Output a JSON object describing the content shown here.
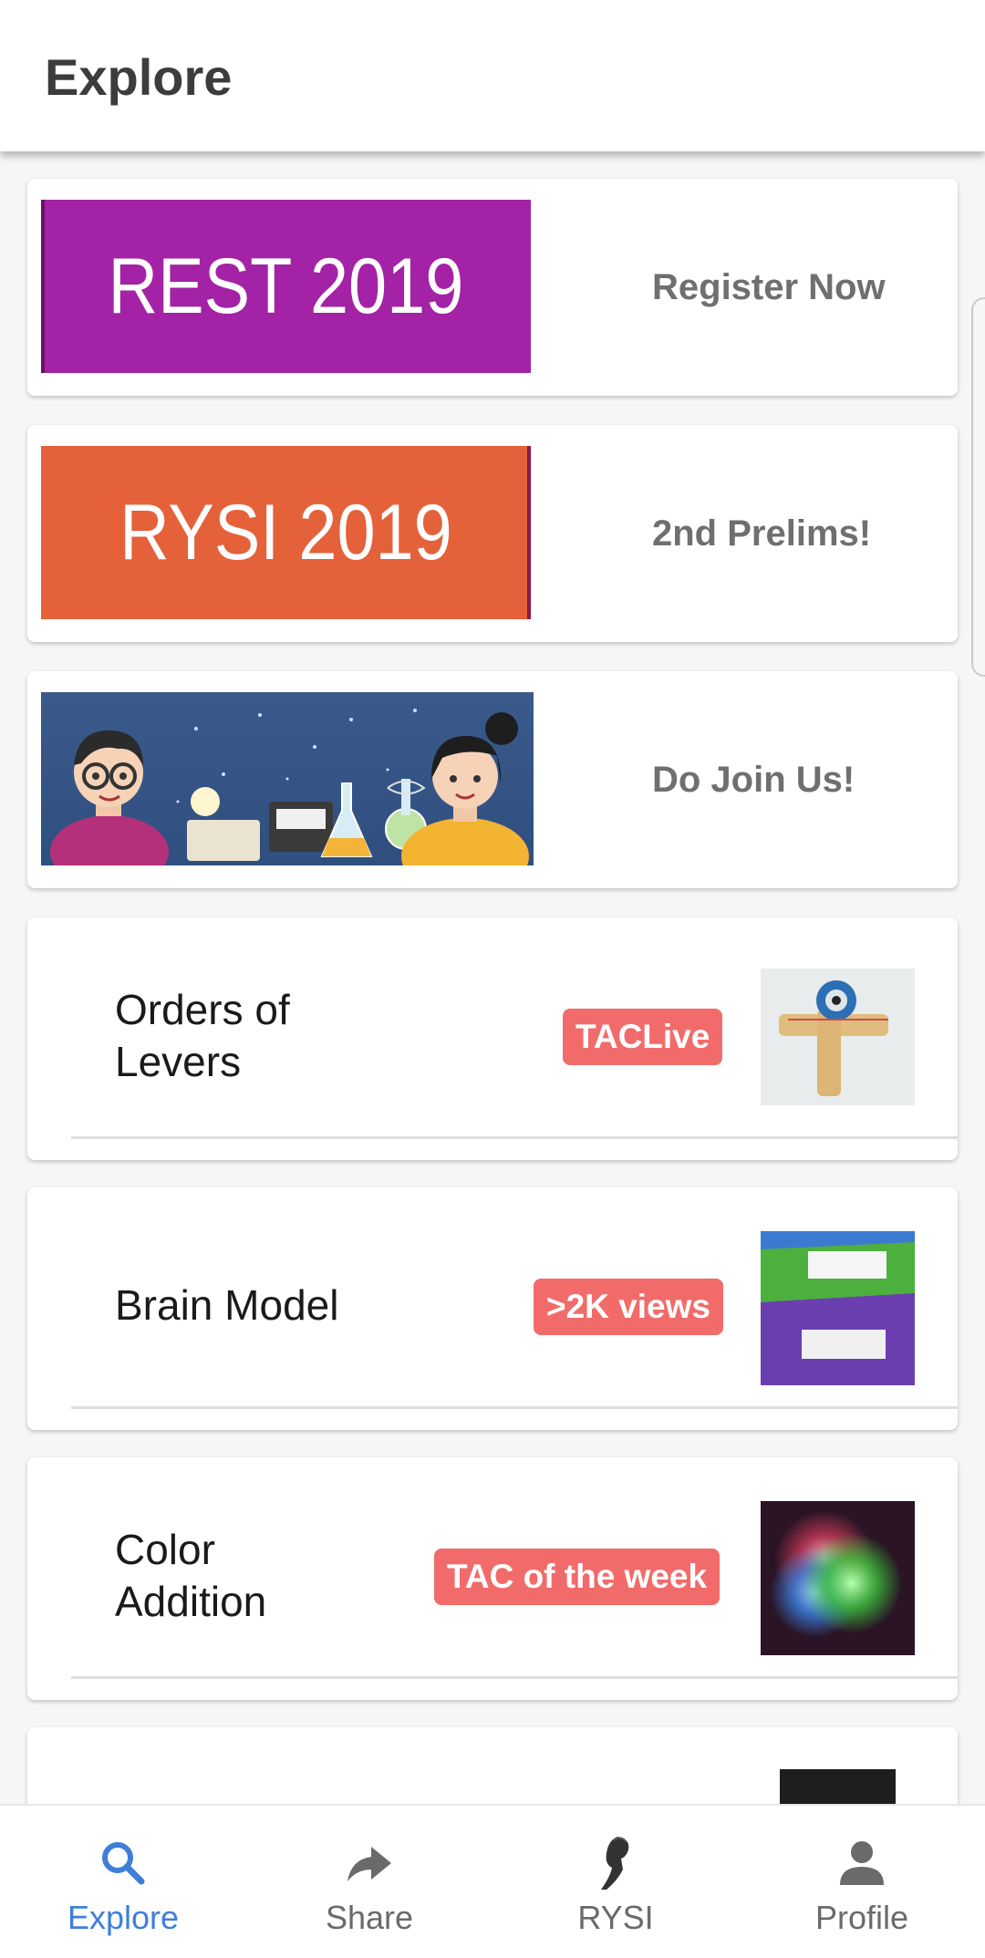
{
  "appbar": {
    "title": "Explore"
  },
  "banners": [
    {
      "image_text": "REST 2019",
      "image_color": "#a020a0",
      "label": "Register Now"
    },
    {
      "image_text": "RYSI 2019",
      "image_color": "#e4613a",
      "label": "2nd Prelims!"
    },
    {
      "image_text": "",
      "label": "Do Join Us!"
    }
  ],
  "posts": [
    {
      "title_line1": "Orders of",
      "title_line2": "Levers",
      "badge": "TACLive"
    },
    {
      "title_line1": "Brain Model",
      "title_line2": "",
      "badge": ">2K views"
    },
    {
      "title_line1": "Color",
      "title_line2": "Addition",
      "badge": "TAC of the week"
    }
  ],
  "bottom_nav": {
    "items": [
      {
        "label": "Explore",
        "icon": "search-icon",
        "active": true
      },
      {
        "label": "Share",
        "icon": "share-arrow-icon",
        "active": false
      },
      {
        "label": "RYSI",
        "icon": "rysi-logo-icon",
        "active": false
      },
      {
        "label": "Profile",
        "icon": "person-icon",
        "active": false
      }
    ]
  },
  "colors": {
    "accent": "#3f7fd8",
    "badge": "#f26b6b"
  }
}
